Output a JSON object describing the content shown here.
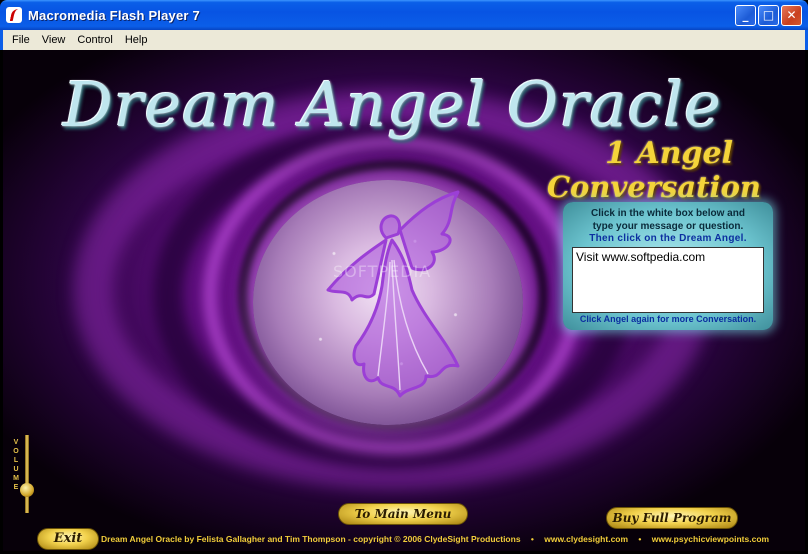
{
  "window": {
    "title": "Macromedia Flash Player 7",
    "minimize_glyph": "_",
    "maximize_glyph": "□",
    "close_glyph": "✕"
  },
  "menu": {
    "items": [
      "File",
      "View",
      "Control",
      "Help"
    ]
  },
  "app": {
    "title": "Dream Angel Oracle",
    "subtitle_line1": "1 Angel",
    "subtitle_line2": "Conversation",
    "watermark": "SOFTPEDIA",
    "panel": {
      "instruction_line1": "Click in the white box below and",
      "instruction_line2": "type your message or question.",
      "instruction_line3": "Then click on the Dream Angel.",
      "message_value": "Visit www.softpedia.com",
      "again_text": "Click Angel again for more Conversation."
    },
    "volume_label": [
      "V",
      "O",
      "L",
      "U",
      "M",
      "E"
    ],
    "volume_level": 0.3,
    "buttons": {
      "main_menu": "To Main Menu",
      "buy": "Buy Full Program",
      "exit": "Exit"
    },
    "footer": {
      "credit": "Dream Angel Oracle by Felista Gallagher and Tim Thompson - copyright © 2006 ClydeSight Productions",
      "site1": "www.clydesight.com",
      "site2": "www.psychicviewpoints.com"
    }
  },
  "colors": {
    "title_text": "#bfe6ee",
    "gold": "#f4d43a",
    "panel": "#6cc4cf",
    "instruction_blue": "#0b2fa0",
    "background_purple": "#8a1dab"
  },
  "icons": {
    "app": "flash-player-icon",
    "angel": "angel-figure-icon"
  }
}
